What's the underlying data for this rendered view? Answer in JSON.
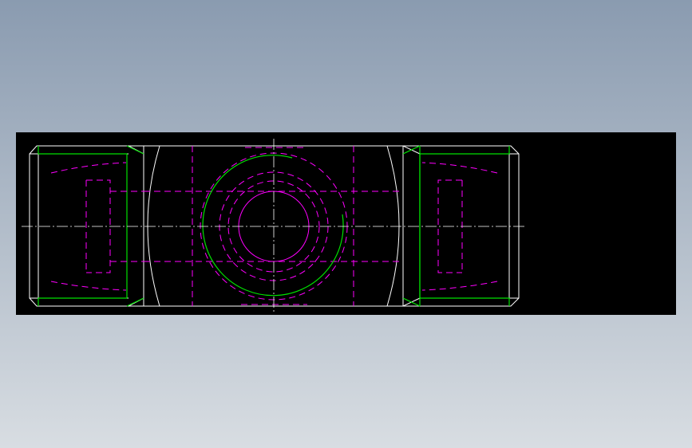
{
  "colors": {
    "background_top": "#8a9bb0",
    "background_bottom": "#d8dde2",
    "canvas": "#000000",
    "outline": "#ffffff",
    "thread": "#00e000",
    "hidden": "#ff00ff",
    "centerline": "#ffffff"
  },
  "drawing": {
    "view": "front",
    "line_types": [
      "continuous",
      "hidden-dashed",
      "centerline-dash-dot"
    ]
  }
}
